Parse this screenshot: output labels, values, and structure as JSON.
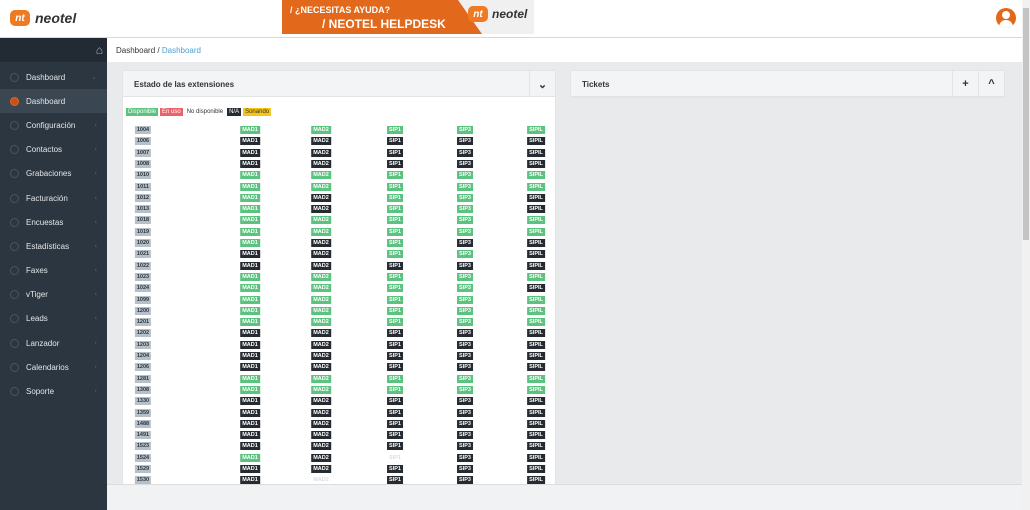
{
  "header": {
    "logo": "neotel",
    "logo_mark": "nt",
    "banner_line1": "/ ¿NECESITAS AYUDA?",
    "banner_line2": "/ NEOTEL HELPDESK",
    "banner_logo": "neotel"
  },
  "sidebar": {
    "items": [
      {
        "label": "Dashboard",
        "icon": "dashboard-icon"
      },
      {
        "label": "Dashboard",
        "icon": "dashboard-icon",
        "active": true
      },
      {
        "label": "Configuración"
      },
      {
        "label": "Contactos"
      },
      {
        "label": "Grabaciones"
      },
      {
        "label": "Facturación"
      },
      {
        "label": "Encuestas"
      },
      {
        "label": "Estadísticas"
      },
      {
        "label": "Faxes"
      },
      {
        "label": "vTiger"
      },
      {
        "label": "Leads"
      },
      {
        "label": "Lanzador"
      },
      {
        "label": "Calendarios"
      },
      {
        "label": "Soporte"
      }
    ]
  },
  "breadcrumb": {
    "root": "Dashboard",
    "sep": "/",
    "current": "Dashboard"
  },
  "extensions": {
    "title": "Estado de las extensiones",
    "legend": {
      "disponible": "Disponible",
      "en_uso": "En uso",
      "no_disponible": "No disponible",
      "na": "N/A",
      "sonando": "Sonando"
    },
    "colors": {
      "disponible": "#5cc27f",
      "en_uso": "#e8646a",
      "na": "#252b31",
      "sonando": "#f5c518"
    },
    "columns": [
      "MAD1",
      "MAD2",
      "SIP1",
      "SIP3",
      "SIPIL"
    ],
    "rows": [
      {
        "ext": "1004",
        "status": "ggggg"
      },
      {
        "ext": "1006",
        "status": "ddddd"
      },
      {
        "ext": "1007",
        "status": "ddddd"
      },
      {
        "ext": "1008",
        "status": "ddddd"
      },
      {
        "ext": "1010",
        "status": "ggggg"
      },
      {
        "ext": "1011",
        "status": "ggggg"
      },
      {
        "ext": "1012",
        "status": "gdggd"
      },
      {
        "ext": "1013",
        "status": "gdggd"
      },
      {
        "ext": "1018",
        "status": "ggggg"
      },
      {
        "ext": "1019",
        "status": "ggggg"
      },
      {
        "ext": "1020",
        "status": "gdgdd"
      },
      {
        "ext": "1021",
        "status": "ddggd"
      },
      {
        "ext": "1022",
        "status": "ddddd"
      },
      {
        "ext": "1023",
        "status": "ggggg"
      },
      {
        "ext": "1024",
        "status": "ggggd"
      },
      {
        "ext": "1099",
        "status": "ggggg"
      },
      {
        "ext": "1200",
        "status": "ggggg"
      },
      {
        "ext": "1201",
        "status": "ggggg"
      },
      {
        "ext": "1202",
        "status": "ddddd"
      },
      {
        "ext": "1203",
        "status": "ddddd"
      },
      {
        "ext": "1204",
        "status": "ddddd"
      },
      {
        "ext": "1206",
        "status": "ddddd"
      },
      {
        "ext": "1281",
        "status": "ggggg"
      },
      {
        "ext": "1308",
        "status": "ggggg"
      },
      {
        "ext": "1330",
        "status": "ddddd"
      },
      {
        "ext": "1359",
        "status": "ddddd"
      },
      {
        "ext": "1488",
        "status": "ddddd"
      },
      {
        "ext": "1491",
        "status": "ddddd"
      },
      {
        "ext": "1523",
        "status": "ddddd"
      },
      {
        "ext": "1524",
        "status": "gdedd"
      },
      {
        "ext": "1529",
        "status": "ddddd"
      },
      {
        "ext": "1530",
        "status": "deddd"
      }
    ]
  },
  "tickets": {
    "title": "Tickets",
    "add": "+",
    "collapse": "^"
  }
}
